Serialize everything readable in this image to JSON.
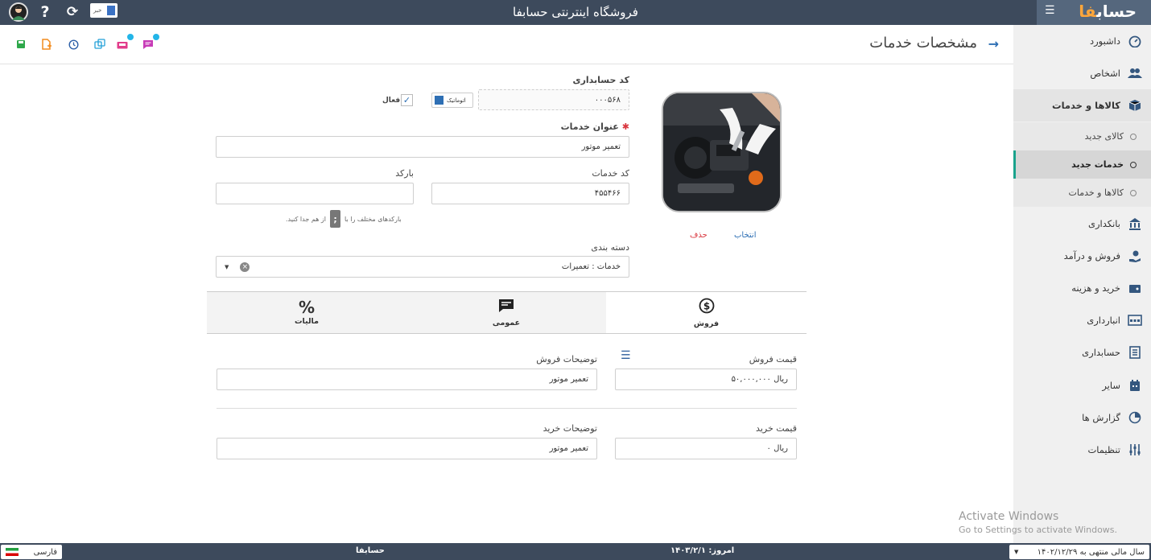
{
  "topbar": {
    "title": "فروشگاه اینترنتی حسابفا",
    "news_label": "خبر",
    "brand": {
      "prefix": "حساب",
      "accent": "فا"
    }
  },
  "sidebar": {
    "items": [
      {
        "label": "داشبورد",
        "icon": "dashboard-icon"
      },
      {
        "label": "اشخاص",
        "icon": "people-icon"
      },
      {
        "label": "کالاها و خدمات",
        "icon": "box-icon"
      },
      {
        "label": "بانکداری",
        "icon": "bank-icon"
      },
      {
        "label": "فروش و درآمد",
        "icon": "hand-money-icon"
      },
      {
        "label": "خرید و هزینه",
        "icon": "wallet-icon"
      },
      {
        "label": "انبارداری",
        "icon": "warehouse-icon"
      },
      {
        "label": "حسابداری",
        "icon": "ledger-icon"
      },
      {
        "label": "سایر",
        "icon": "grid-icon"
      },
      {
        "label": "گزارش ها",
        "icon": "report-icon"
      },
      {
        "label": "تنظیمات",
        "icon": "sliders-icon"
      }
    ],
    "sub_items": [
      {
        "label": "کالای جدید"
      },
      {
        "label": "خدمات جدید"
      },
      {
        "label": "کالاها و خدمات"
      }
    ]
  },
  "header": {
    "page_title": "مشخصات خدمات"
  },
  "form": {
    "accounting_code_label": "کد حسابداری",
    "accounting_code_value": "۰۰۰۵۶۸",
    "auto_label": "اتوماتیک",
    "active_label": "فعال",
    "service_title_label": "عنوان خدمات",
    "service_title_value": "تعمیر موتور",
    "service_code_label": "کد خدمات",
    "service_code_value": "۴۵۵۴۶۶",
    "barcode_label": "بارکد",
    "barcode_value": "",
    "barcode_hint_pre": "بارکدهای مختلف را با",
    "barcode_hint_key": ";",
    "barcode_hint_post": "از هم جدا کنید.",
    "category_label": "دسته بندی",
    "category_value": "خدمات : تعمیرات",
    "select_link": "انتخاب",
    "delete_link": "حذف"
  },
  "tabs": [
    {
      "label": "فروش",
      "icon": "dollar-circle-icon"
    },
    {
      "label": "عمومی",
      "icon": "chat-icon"
    },
    {
      "label": "مالیات",
      "icon": "percent-icon"
    }
  ],
  "sales": {
    "price_label": "قیمت فروش",
    "price_value": "ریال ۵۰,۰۰۰,۰۰۰",
    "desc_label": "توضیحات فروش",
    "desc_value": "تعمیر موتور"
  },
  "purchase": {
    "price_label": "قیمت خرید",
    "price_value": "ریال ۰",
    "desc_label": "توضیحات خرید",
    "desc_value": "تعمیر موتور"
  },
  "footer": {
    "company": "حسابفا",
    "today": "امروز: ۱۴۰۳/۲/۱",
    "language": "فارسی",
    "fiscal_year": "سال مالی منتهی به ۱۴۰۲/۱۲/۲۹"
  },
  "watermark": {
    "line1": "Activate Windows",
    "line2": "Go to Settings to activate Windows."
  },
  "colors": {
    "topbar": "#3d4a5c",
    "accent": "#2e6fb4",
    "brand_accent": "#ffa63a",
    "active_border": "#1aa38c",
    "required": "#d9363e"
  }
}
